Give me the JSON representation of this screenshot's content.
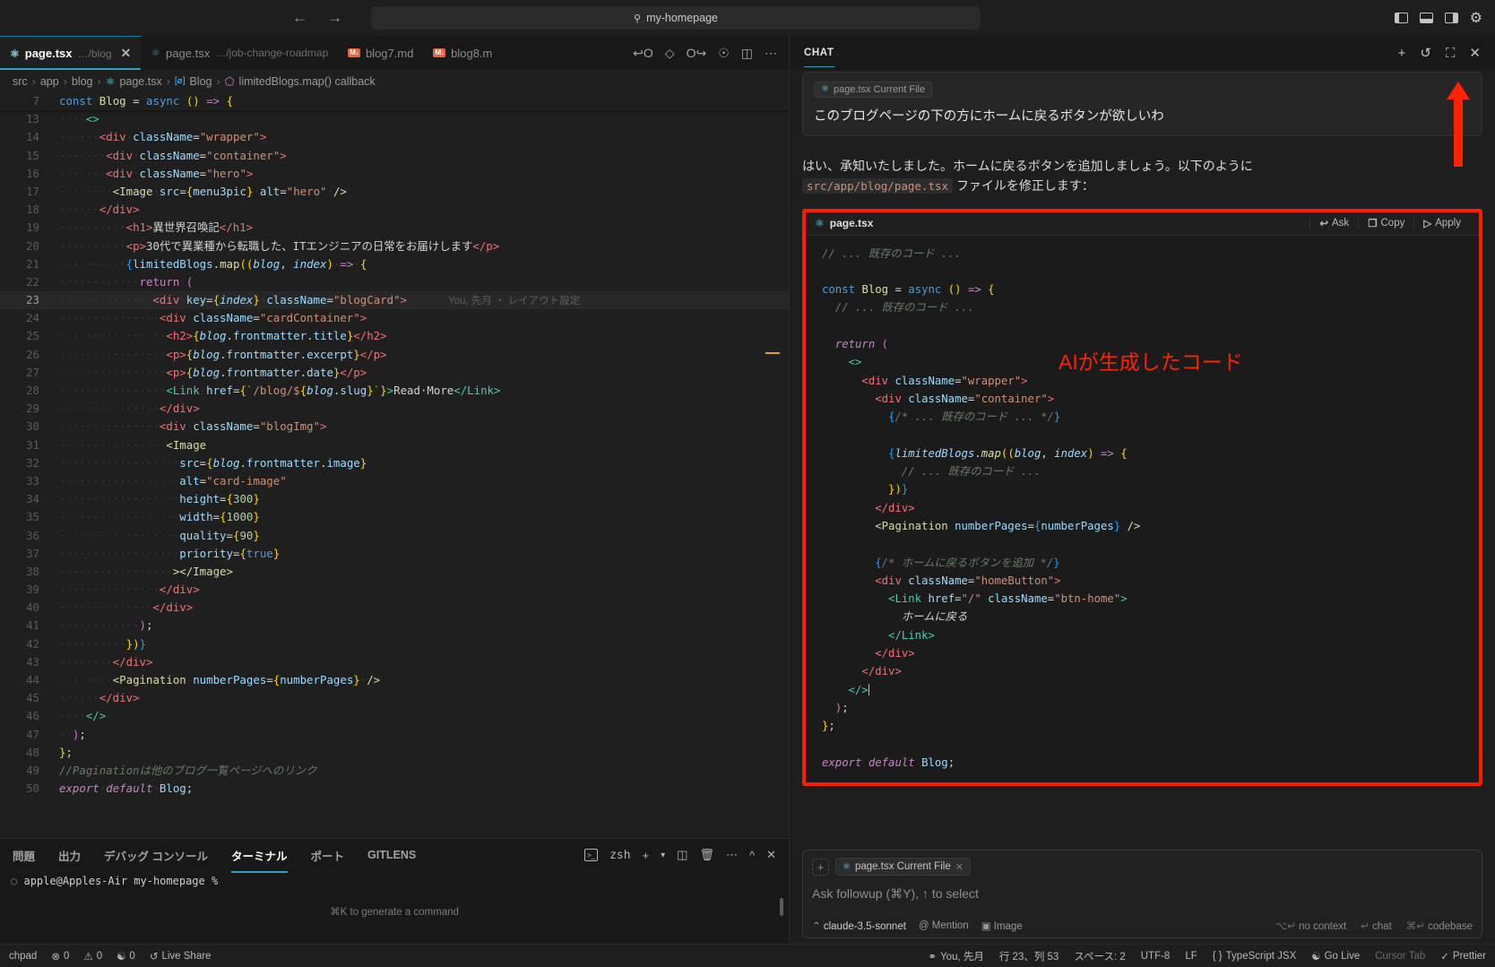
{
  "titlebar": {
    "back_icon": "←",
    "forward_icon": "→",
    "search_icon": "⚲",
    "omnibox_value": "my-homepage",
    "layout_left_icon": "panel-left-icon",
    "layout_bottom_icon": "panel-bottom-icon",
    "layout_right_icon": "panel-right-icon",
    "settings_icon": "⚙"
  },
  "tabs": [
    {
      "name": "page.tsx",
      "path": "…/blog",
      "icon": "react-icon",
      "active": true,
      "close": "✕"
    },
    {
      "name": "page.tsx",
      "path": "…/job-change-roadmap",
      "icon": "react-icon",
      "active": false
    },
    {
      "name": "blog7.md",
      "path": "",
      "icon": "md-icon",
      "active": false
    },
    {
      "name": "blog8.m",
      "path": "",
      "icon": "md-icon",
      "active": false
    }
  ],
  "tab_actions": [
    "prev-edit-icon",
    "circle-icon",
    "next-edit-icon",
    "run-icon",
    "split-editor-icon",
    "more-icon"
  ],
  "breadcrumb": [
    "src",
    "app",
    "blog",
    "page.tsx",
    "Blog",
    "limitedBlogs.map() callback"
  ],
  "editor": {
    "sticky_line_number": "7",
    "lines": [
      {
        "n": "13",
        "t": "       <>"
      },
      {
        "n": "14",
        "t": "         <div className=\"wrapper\">"
      },
      {
        "n": "15",
        "t": "          <div className=\"container\">"
      },
      {
        "n": "16",
        "t": "          <div className=\"hero\">"
      },
      {
        "n": "17",
        "t": "           <Image src={menu3pic} alt=\"hero\" />"
      },
      {
        "n": "18",
        "t": "         </div>"
      },
      {
        "n": "19",
        "t": "            <h1>異世界召喚記</h1>"
      },
      {
        "n": "20",
        "t": "            <p>30代で異業種から転職した、ITエンジニアの日常をお届けします</p>"
      },
      {
        "n": "21",
        "t": "            {limitedBlogs.map((blog, index) => {"
      },
      {
        "n": "22",
        "t": "              return ("
      },
      {
        "n": "23",
        "t": "                <div key={index} className=\"blogCard\">"
      },
      {
        "n": "24",
        "t": "                 <div className=\"cardContainer\">"
      },
      {
        "n": "25",
        "t": "                  <h2>{blog.frontmatter.title}</h2>"
      },
      {
        "n": "26",
        "t": "                  <p>{blog.frontmatter.excerpt}</p>"
      },
      {
        "n": "27",
        "t": "                  <p>{blog.frontmatter.date}</p>"
      },
      {
        "n": "28",
        "t": "                  <Link href={`/blog/${blog.slug}`}>Read More</Link>"
      },
      {
        "n": "29",
        "t": "                 </div>"
      },
      {
        "n": "30",
        "t": "                 <div className=\"blogImg\">"
      },
      {
        "n": "31",
        "t": "                  <Image"
      },
      {
        "n": "32",
        "t": "                    src={blog.frontmatter.image}"
      },
      {
        "n": "33",
        "t": "                    alt=\"card-image\""
      },
      {
        "n": "34",
        "t": "                    height={300}"
      },
      {
        "n": "35",
        "t": "                    width={1000}"
      },
      {
        "n": "36",
        "t": "                    quality={90}"
      },
      {
        "n": "37",
        "t": "                    priority={true}"
      },
      {
        "n": "38",
        "t": "                   ></Image>"
      },
      {
        "n": "39",
        "t": "                 </div>"
      },
      {
        "n": "40",
        "t": "                </div>"
      },
      {
        "n": "41",
        "t": "              );"
      },
      {
        "n": "42",
        "t": "            })}"
      },
      {
        "n": "43",
        "t": "          </div>"
      },
      {
        "n": "44",
        "t": "          <Pagination numberPages={numberPages} />"
      },
      {
        "n": "45",
        "t": "        </div>"
      },
      {
        "n": "46",
        "t": "      </>"
      },
      {
        "n": "47",
        "t": "  );"
      },
      {
        "n": "48",
        "t": "};"
      },
      {
        "n": "49",
        "t": "//Paginationは他のブログ一覧ページへのリンク"
      },
      {
        "n": "50",
        "t": "export default Blog;"
      }
    ],
    "sticky_code": "const Blog = async () => {",
    "codelens_line23": "You, 先月 ・ レイアウト設定"
  },
  "panel": {
    "tabs": [
      "問題",
      "出力",
      "デバッグ コンソール",
      "ターミナル",
      "ポート",
      "GITLENS"
    ],
    "active_tab": "ターミナル",
    "shell_label": "zsh",
    "actions": [
      "new-terminal-icon",
      "chevron-down-icon",
      "split-terminal-icon",
      "trash-icon",
      "more-icon",
      "chevron-up-icon",
      "close-icon"
    ],
    "prompt": "apple@Apples-Air my-homepage %",
    "hint": "⌘K to generate a command"
  },
  "chat": {
    "title": "CHAT",
    "head_actions": [
      "new-chat-icon",
      "history-icon",
      "maximize-icon",
      "close-icon"
    ],
    "more_icon": "…",
    "user": {
      "context_chip": "page.tsx Current File",
      "chip_icon": "react-icon",
      "message": "このブログページの下の方にホームに戻るボタンが欲しいわ"
    },
    "assistant": {
      "line1": "はい、承知いたしました。ホームに戻るボタンを追加しましょう。以下のように",
      "filepath": "src/app/blog/page.tsx",
      "line2_tail": "ファイルを修正します："
    },
    "codeblock": {
      "filename": "page.tsx",
      "file_icon": "react-icon",
      "ask_label": "Ask",
      "copy_label": "Copy",
      "apply_label": "Apply",
      "ask_icon": "↩",
      "copy_icon": "❐",
      "apply_icon": "▷",
      "lines": [
        "// ... 既存のコード ...",
        "",
        "const Blog = async () => {",
        "  // ... 既存のコード ...",
        "",
        "  return (",
        "    <>",
        "      <div className=\"wrapper\">",
        "        <div className=\"container\">",
        "          {/* ... 既存のコード ... */}",
        "",
        "          {limitedBlogs.map((blog, index) => {",
        "            // ... 既存のコード ...",
        "          })}",
        "        </div>",
        "        <Pagination numberPages={numberPages} />",
        "",
        "        {/* ホームに戻るボタンを追加 */}",
        "        <div className=\"homeButton\">",
        "          <Link href=\"/\" className=\"btn-home\">",
        "            ホームに戻る",
        "          </Link>",
        "        </div>",
        "      </div>",
        "    </>",
        "  );",
        "};",
        "",
        "export default Blog;"
      ]
    },
    "annotation": "AIが生成したコード",
    "annotation_color": "#ff2200",
    "highlight_color": "#ff1a00",
    "input": {
      "plus_icon": "+",
      "file_chip": "page.tsx Current File",
      "file_chip_icon": "react-icon",
      "file_chip_close": "✕",
      "placeholder": "Ask followup (⌘Y), ↑ to select",
      "model": "claude-3.5-sonnet",
      "model_caret": "⌃",
      "mention_label": "@ Mention",
      "image_label": "Image",
      "no_context": "no context",
      "chat_label": "chat",
      "codebase_label": "codebase",
      "no_context_key": "⌥↵",
      "chat_key": "↵",
      "codebase_key": "⌘↵"
    }
  },
  "status": {
    "left": [
      "chpad",
      "0",
      "0",
      "0",
      "Live Share"
    ],
    "error_icon": "⊗",
    "warn_icon": "⚠",
    "radio_icon": "📡",
    "liveshare_icon": "↺",
    "right": [
      {
        "label": "You, 先月",
        "icon": "source-control-icon"
      },
      {
        "label": "行 23、列 53",
        "icon": ""
      },
      {
        "label": "スペース: 2",
        "icon": ""
      },
      {
        "label": "UTF-8",
        "icon": ""
      },
      {
        "label": "LF",
        "icon": ""
      },
      {
        "label": "TypeScript JSX",
        "icon": "braces-icon"
      },
      {
        "label": "Go Live",
        "icon": "broadcast-icon"
      },
      {
        "label": "Cursor Tab",
        "icon": ""
      },
      {
        "label": "Prettier",
        "icon": "check-icon"
      }
    ]
  }
}
